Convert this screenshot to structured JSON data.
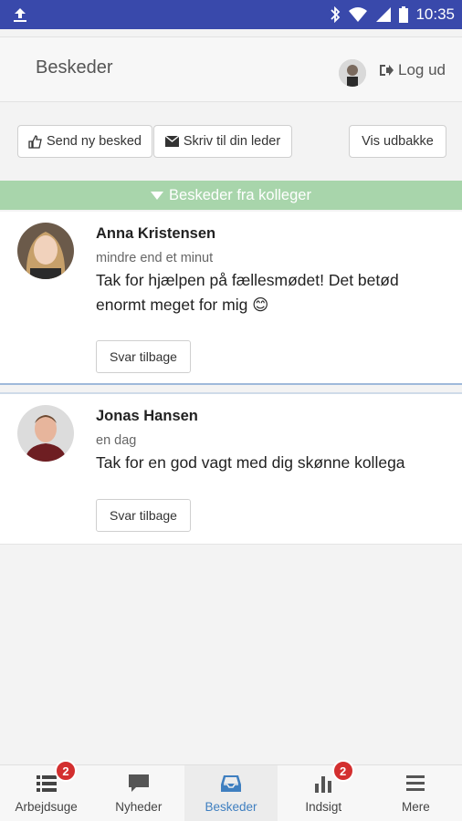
{
  "status_bar": {
    "time": "10:35"
  },
  "header": {
    "title": "Beskeder",
    "logout_label": "Log ud"
  },
  "toolbar": {
    "send_new_label": "Send ny besked",
    "write_leader_label": "Skriv til din leder",
    "outbox_label": "Vis udbakke"
  },
  "section": {
    "title": "Beskeder fra kolleger"
  },
  "messages": [
    {
      "name": "Anna Kristensen",
      "time": "mindre end et minut",
      "text": "Tak for hjælpen på fællesmødet! Det betød enormt meget for mig 😊",
      "reply_label": "Svar tilbage"
    },
    {
      "name": "Jonas Hansen",
      "time": "en dag",
      "text": "Tak for en god vagt med dig skønne kollega",
      "reply_label": "Svar tilbage"
    }
  ],
  "nav": [
    {
      "label": "Arbejdsuge",
      "badge": "2",
      "icon": "list-icon"
    },
    {
      "label": "Nyheder",
      "icon": "chat-bubble-icon"
    },
    {
      "label": "Beskeder",
      "icon": "inbox-icon",
      "active": true
    },
    {
      "label": "Indsigt",
      "badge": "2",
      "icon": "bar-chart-icon"
    },
    {
      "label": "Mere",
      "icon": "menu-icon"
    }
  ],
  "colors": {
    "status_bar": "#3949ab",
    "section_header": "#a8d5ab",
    "active_nav": "#3f7fc0",
    "badge": "#d32f2f"
  }
}
